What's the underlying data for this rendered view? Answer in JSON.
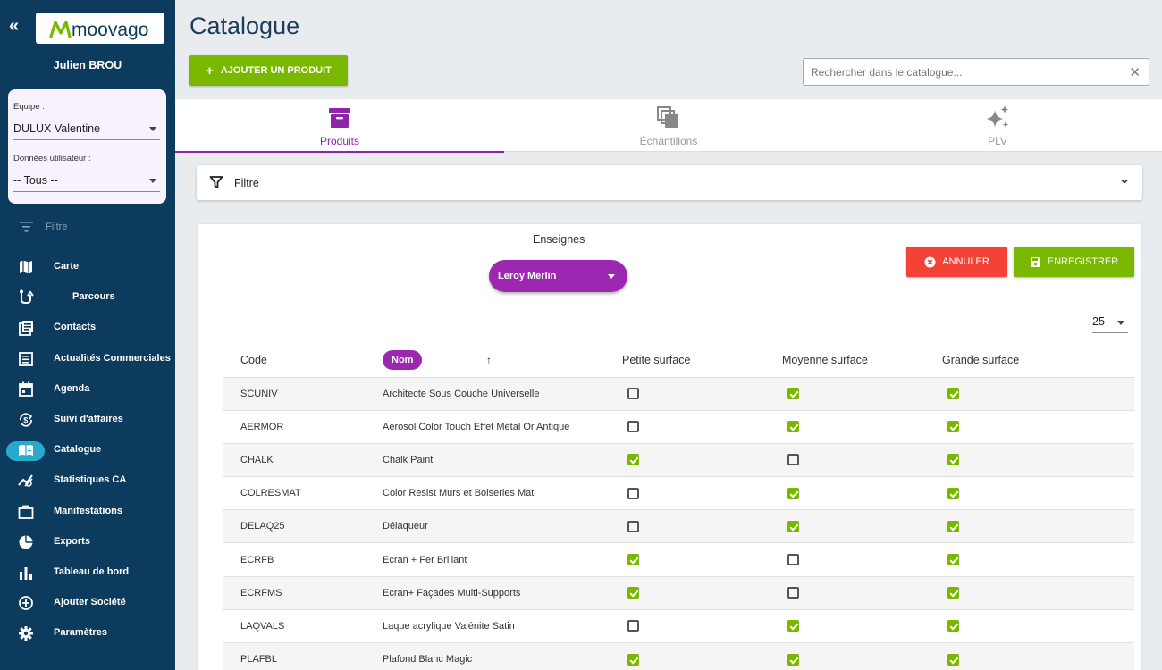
{
  "sidebar": {
    "logo_text": "moovago",
    "user_name": "Julien BROU",
    "team_label": "Equipe :",
    "team_value": "DULUX Valentine",
    "user_data_label": "Données utilisateur :",
    "user_data_value": "-- Tous --",
    "filter_label": "Filtre",
    "items": [
      {
        "label": "Carte",
        "icon": "map-icon"
      },
      {
        "label": "Parcours",
        "icon": "route-icon"
      },
      {
        "label": "Contacts",
        "icon": "contacts-icon"
      },
      {
        "label": "Actualités Commerciales",
        "icon": "news-icon"
      },
      {
        "label": "Agenda",
        "icon": "calendar-icon"
      },
      {
        "label": "Suivi d'affaires",
        "icon": "deals-icon"
      },
      {
        "label": "Catalogue",
        "icon": "catalogue-icon"
      },
      {
        "label": "Statistiques CA",
        "icon": "stats-icon"
      },
      {
        "label": "Manifestations",
        "icon": "briefcase-icon"
      },
      {
        "label": "Exports",
        "icon": "pie-icon"
      },
      {
        "label": "Tableau de bord",
        "icon": "bar-chart-icon"
      },
      {
        "label": "Ajouter Société",
        "icon": "add-circle-icon"
      },
      {
        "label": "Paramètres",
        "icon": "gear-icon"
      }
    ]
  },
  "header": {
    "title": "Catalogue",
    "add_button": "AJOUTER UN PRODUIT",
    "search_placeholder": "Rechercher dans le catalogue..."
  },
  "tabs": [
    {
      "label": "Produits",
      "active": true
    },
    {
      "label": "Échantillons",
      "active": false
    },
    {
      "label": "PLV",
      "active": false
    }
  ],
  "filter_panel": {
    "label": "Filtre"
  },
  "content": {
    "enseigne_label": "Enseignes",
    "enseigne_value": "Leroy Merlin",
    "cancel_button": "ANNULER",
    "save_button": "ENREGISTRER",
    "page_size": "25"
  },
  "table": {
    "headers": {
      "code": "Code",
      "nom": "Nom",
      "petite": "Petite surface",
      "moyenne": "Moyenne surface",
      "grande": "Grande surface"
    },
    "rows": [
      {
        "code": "SCUNIV",
        "nom": "Architecte Sous Couche Universelle",
        "petite": false,
        "moyenne": true,
        "grande": true
      },
      {
        "code": "AERMOR",
        "nom": "Aérosol Color Touch Effet Métal Or Antique",
        "petite": false,
        "moyenne": true,
        "grande": true
      },
      {
        "code": "CHALK",
        "nom": "Chalk Paint",
        "petite": true,
        "moyenne": false,
        "grande": true
      },
      {
        "code": "COLRESMAT",
        "nom": "Color Resist Murs et Boiseries Mat",
        "petite": false,
        "moyenne": true,
        "grande": true
      },
      {
        "code": "DELAQ25",
        "nom": "Délaqueur",
        "petite": false,
        "moyenne": true,
        "grande": true
      },
      {
        "code": "ECRFB",
        "nom": "Ecran + Fer Brillant",
        "petite": true,
        "moyenne": false,
        "grande": true
      },
      {
        "code": "ECRFMS",
        "nom": "Ecran+ Façades Multi-Supports",
        "petite": true,
        "moyenne": false,
        "grande": true
      },
      {
        "code": "LAQVALS",
        "nom": "Laque acrylique Valénite Satin",
        "petite": false,
        "moyenne": true,
        "grande": true
      },
      {
        "code": "PLAFBL",
        "nom": "Plafond Blanc Magic",
        "petite": true,
        "moyenne": true,
        "grande": true
      }
    ]
  },
  "colors": {
    "sidebar_bg": "#0d3b5e",
    "accent_green": "#7ab800",
    "accent_purple": "#9c27b0",
    "danger_red": "#f44336",
    "active_nav": "#29aacd"
  }
}
